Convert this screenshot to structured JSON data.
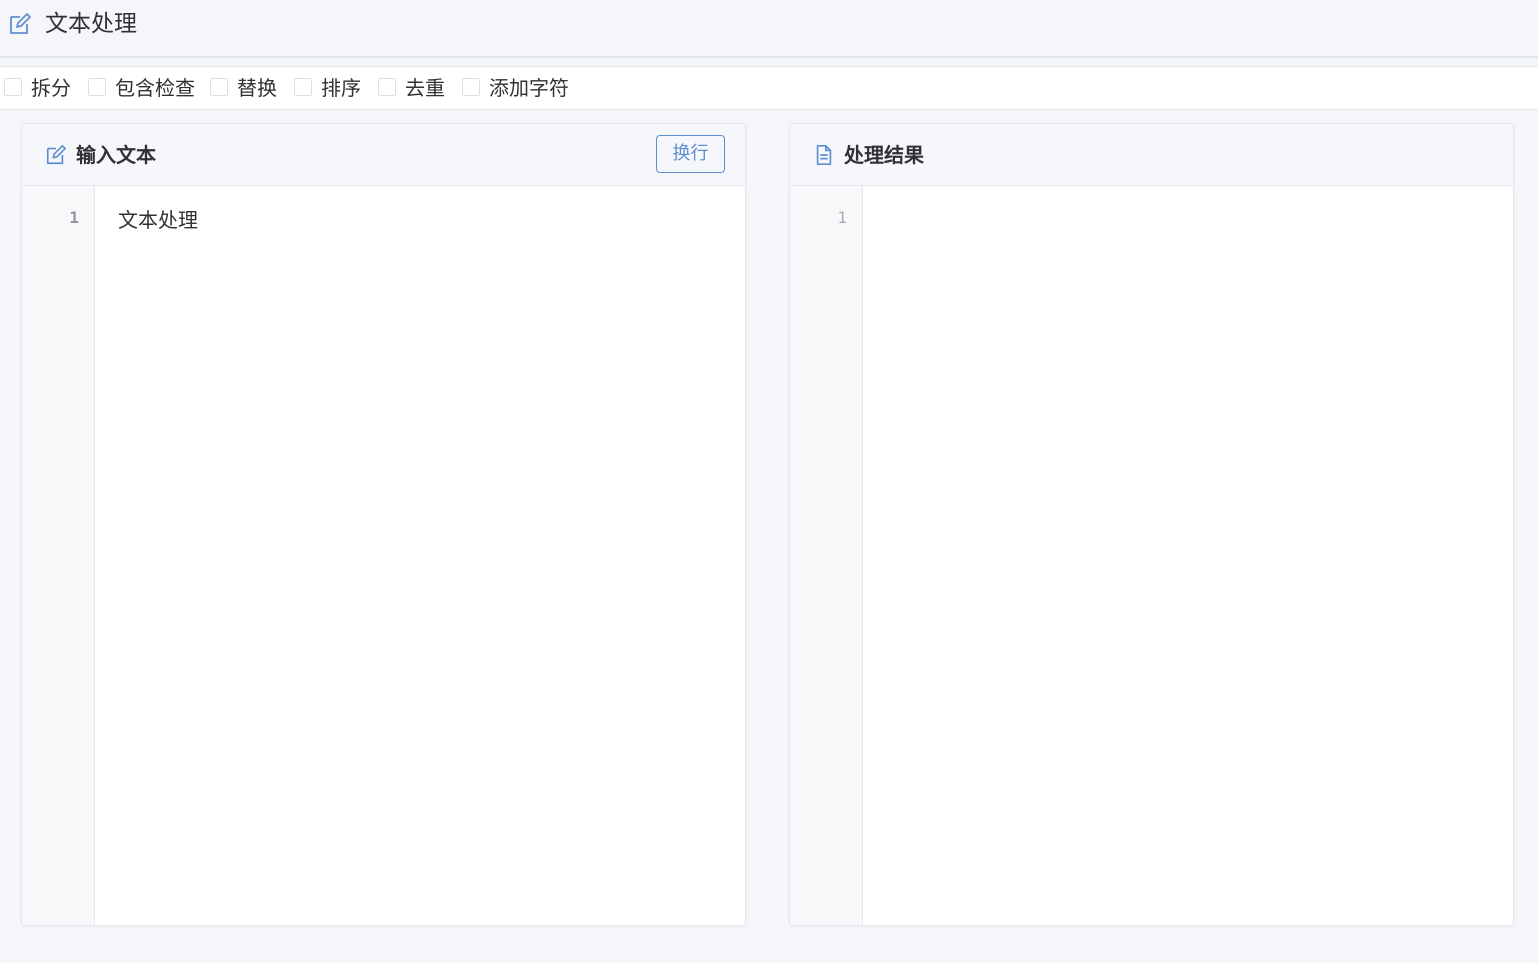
{
  "app": {
    "title": "文本处理",
    "title_icon": "edit-icon"
  },
  "toolbar": {
    "options": [
      {
        "label": "拆分",
        "checked": false
      },
      {
        "label": "包含检查",
        "checked": false
      },
      {
        "label": "替换",
        "checked": false
      },
      {
        "label": "排序",
        "checked": false
      },
      {
        "label": "去重",
        "checked": false
      },
      {
        "label": "添加字符",
        "checked": false
      }
    ]
  },
  "input_panel": {
    "title": "输入文本",
    "icon": "edit-icon",
    "wrap_button": "换行",
    "line_number": "1",
    "text": "文本处理"
  },
  "output_panel": {
    "title": "处理结果",
    "icon": "document-icon",
    "line_number": "1",
    "text": ""
  },
  "colors": {
    "accent": "#5f8fd1",
    "background": "#f4f6f9",
    "border": "#e4e7ed"
  }
}
